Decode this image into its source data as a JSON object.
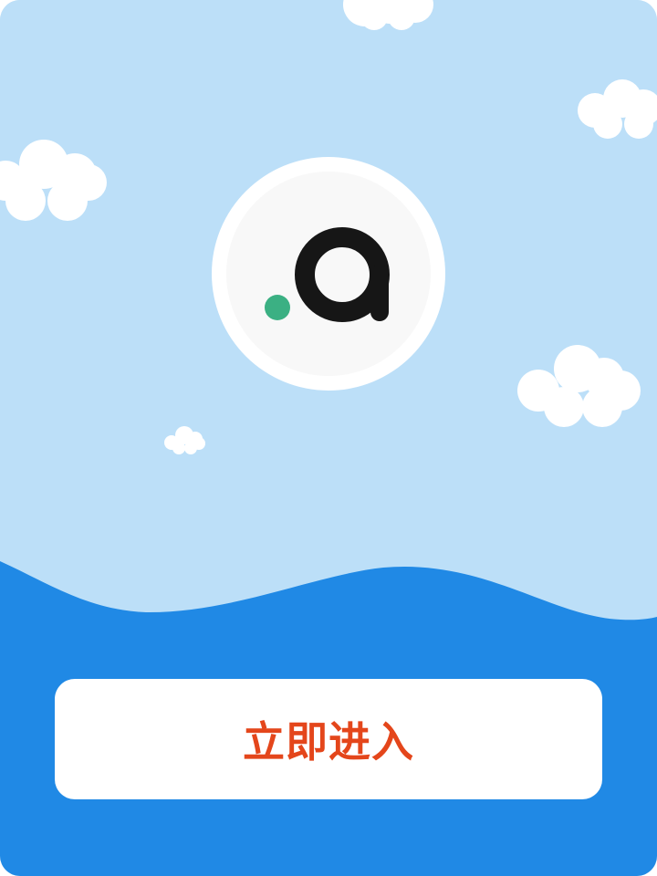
{
  "splash": {
    "enter_label": "立即进入",
    "logo_icon": "app-logo-icon",
    "colors": {
      "sky": "#bcdff8",
      "sea": "#2089e5",
      "button_bg": "#ffffff",
      "button_text": "#e4461b",
      "logo_letter": "#161616",
      "logo_dot": "#3bb083",
      "cloud": "#ffffff"
    }
  }
}
